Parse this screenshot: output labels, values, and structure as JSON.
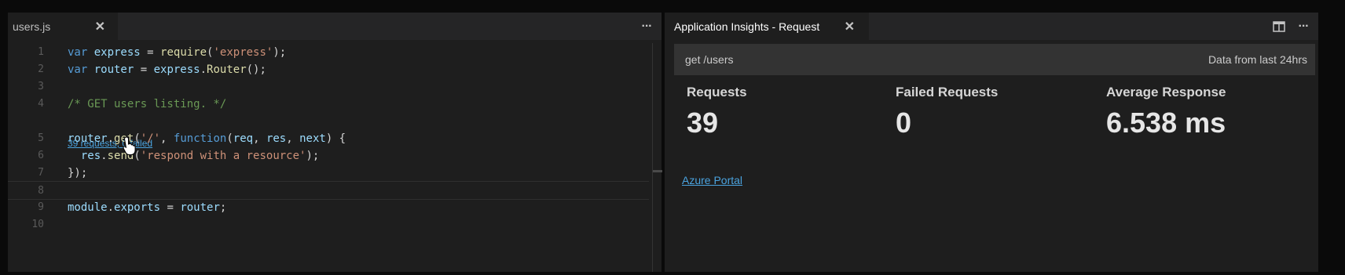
{
  "editor": {
    "tab": {
      "title": "users.js",
      "close": "✕"
    },
    "more_actions": "···",
    "lines": [
      {
        "num": "1",
        "tokens": [
          [
            "k",
            "var "
          ],
          [
            "v",
            "express"
          ],
          [
            "p",
            " = "
          ],
          [
            "f",
            "require"
          ],
          [
            "p",
            "("
          ],
          [
            "s",
            "'express'"
          ],
          [
            "p",
            ");"
          ]
        ]
      },
      {
        "num": "2",
        "tokens": [
          [
            "k",
            "var "
          ],
          [
            "v",
            "router"
          ],
          [
            "p",
            " = "
          ],
          [
            "v",
            "express"
          ],
          [
            "p",
            "."
          ],
          [
            "f",
            "Router"
          ],
          [
            "p",
            "();"
          ]
        ]
      },
      {
        "num": "3",
        "tokens": []
      },
      {
        "num": "4",
        "tokens": [
          [
            "c",
            "/* GET users listing. */"
          ]
        ]
      },
      {
        "num": "5",
        "tokens": [
          [
            "v",
            "router"
          ],
          [
            "p",
            "."
          ],
          [
            "f",
            "get"
          ],
          [
            "p",
            "("
          ],
          [
            "s",
            "'/'"
          ],
          [
            "p",
            ", "
          ],
          [
            "k",
            "function"
          ],
          [
            "p",
            "("
          ],
          [
            "v",
            "req"
          ],
          [
            "p",
            ", "
          ],
          [
            "v",
            "res"
          ],
          [
            "p",
            ", "
          ],
          [
            "v",
            "next"
          ],
          [
            "p",
            ") {"
          ]
        ]
      },
      {
        "num": "6",
        "tokens": [
          [
            "p",
            "  "
          ],
          [
            "v",
            "res"
          ],
          [
            "p",
            "."
          ],
          [
            "f",
            "send"
          ],
          [
            "p",
            "("
          ],
          [
            "s",
            "'respond with a resource'"
          ],
          [
            "p",
            ");"
          ]
        ]
      },
      {
        "num": "7",
        "tokens": [
          [
            "p",
            "});"
          ]
        ]
      },
      {
        "num": "8",
        "tokens": []
      },
      {
        "num": "9",
        "tokens": [
          [
            "v",
            "module"
          ],
          [
            "p",
            "."
          ],
          [
            "v",
            "exports"
          ],
          [
            "p",
            " = "
          ],
          [
            "v",
            "router"
          ],
          [
            "p",
            ";"
          ]
        ]
      },
      {
        "num": "10",
        "tokens": []
      }
    ],
    "codelens": "39 requests, 0 failed"
  },
  "panel": {
    "tab": {
      "title": "Application Insights - Request",
      "close": "✕"
    },
    "more_actions": "···",
    "header": {
      "route": "get /users",
      "range": "Data from last 24hrs"
    },
    "metrics": {
      "requests": {
        "label": "Requests",
        "value": "39"
      },
      "failed": {
        "label": "Failed Requests",
        "value": "0"
      },
      "average": {
        "label": "Average Response",
        "value": "6.538 ms"
      }
    },
    "link": "Azure Portal"
  },
  "colors": {
    "keyword": "#569cd6",
    "variable": "#9cdcfe",
    "function": "#dcdcaa",
    "string": "#ce9178",
    "comment": "#6a9955",
    "link": "#4aa3df"
  },
  "icons": [
    "close-icon",
    "more-actions-icon",
    "split-editor-icon",
    "mouse-pointer-icon"
  ]
}
